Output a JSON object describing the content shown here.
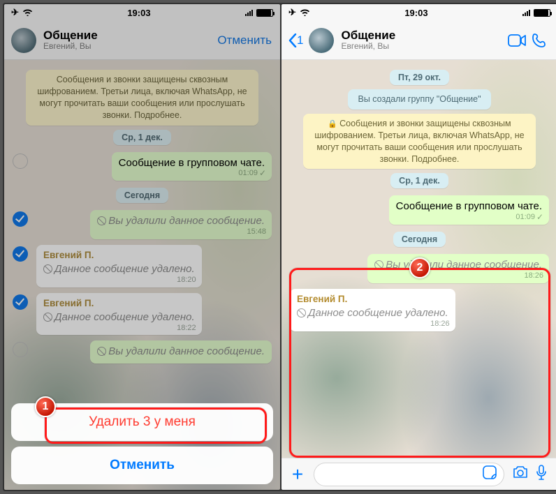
{
  "status": {
    "time": "19:03",
    "airplane": "✈",
    "wifi": "three-bars"
  },
  "chat": {
    "title": "Общение",
    "subtitle": "Евгений, Вы",
    "cancel_label": "Отменить",
    "back_count": "1"
  },
  "encryption_banner": "Сообщения и звонки защищены сквозным шифрованием. Третьи лица, включая WhatsApp, не могут прочитать ваши сообщения или прослушать звонки. Подробнее.",
  "dates": {
    "friday": "Пт, 29 окт.",
    "wed": "Ср, 1 дек.",
    "today": "Сегодня"
  },
  "system_created": "Вы создали группу \"Общение\"",
  "messages": {
    "group_msg": {
      "text": "Сообщение в групповом чате.",
      "time": "01:09"
    },
    "you_deleted_1548": {
      "text": "Вы удалили данное сообщение.",
      "time": "15:48"
    },
    "other_deleted_1820": {
      "sender": "Евгений П.",
      "text": "Данное сообщение удалено.",
      "time": "18:20"
    },
    "other_deleted_1822": {
      "sender": "Евгений П.",
      "text": "Данное сообщение удалено.",
      "time": "18:22"
    },
    "you_deleted_cut": {
      "text": "Вы удалили данное сообщение.",
      "time": ""
    },
    "you_deleted_1826": {
      "text": "Вы удалили данное сообщение.",
      "time": "18:26"
    },
    "other_deleted_1826": {
      "sender": "Евгений П.",
      "text": "Данное сообщение удалено.",
      "time": "18:26"
    }
  },
  "action_sheet": {
    "delete_label": "Удалить 3 у меня",
    "cancel_label": "Отменить"
  },
  "badges": {
    "one": "1",
    "two": "2"
  }
}
